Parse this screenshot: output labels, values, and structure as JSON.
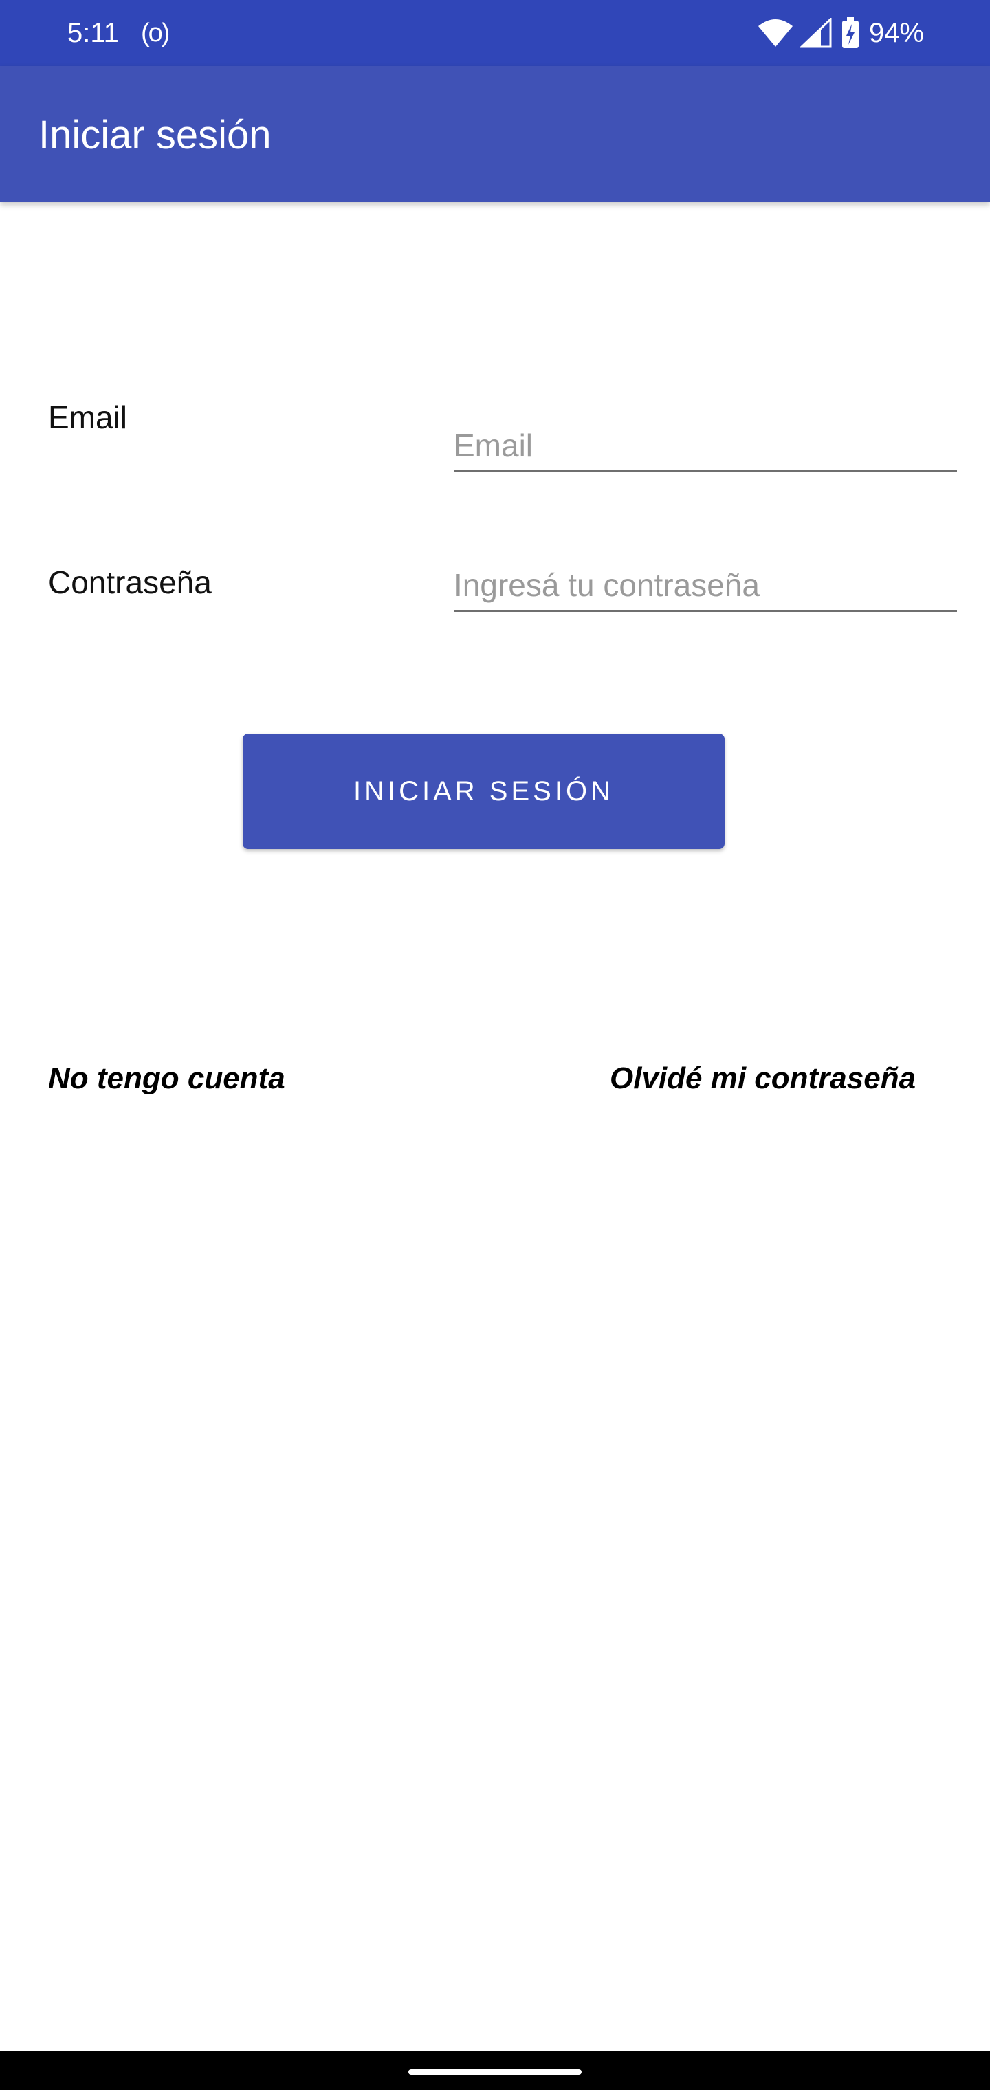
{
  "status_bar": {
    "time": "5:11",
    "radio_indicator": "(o)",
    "battery_percent": "94%",
    "icons": [
      "wifi-icon",
      "signal-icon",
      "battery-charging-icon"
    ],
    "background": "#3046B8"
  },
  "app_bar": {
    "title": "Iniciar sesión",
    "background": "#4052B6"
  },
  "form": {
    "email": {
      "label": "Email",
      "placeholder": "Email",
      "value": ""
    },
    "password": {
      "label": "Contraseña",
      "placeholder": "Ingresá tu contraseña",
      "value": ""
    },
    "submit_label": "INICIAR SESIÓN",
    "accent": "#4052B6"
  },
  "links": {
    "no_account": "No tengo cuenta",
    "forgot_password": "Olvidé mi contraseña"
  }
}
